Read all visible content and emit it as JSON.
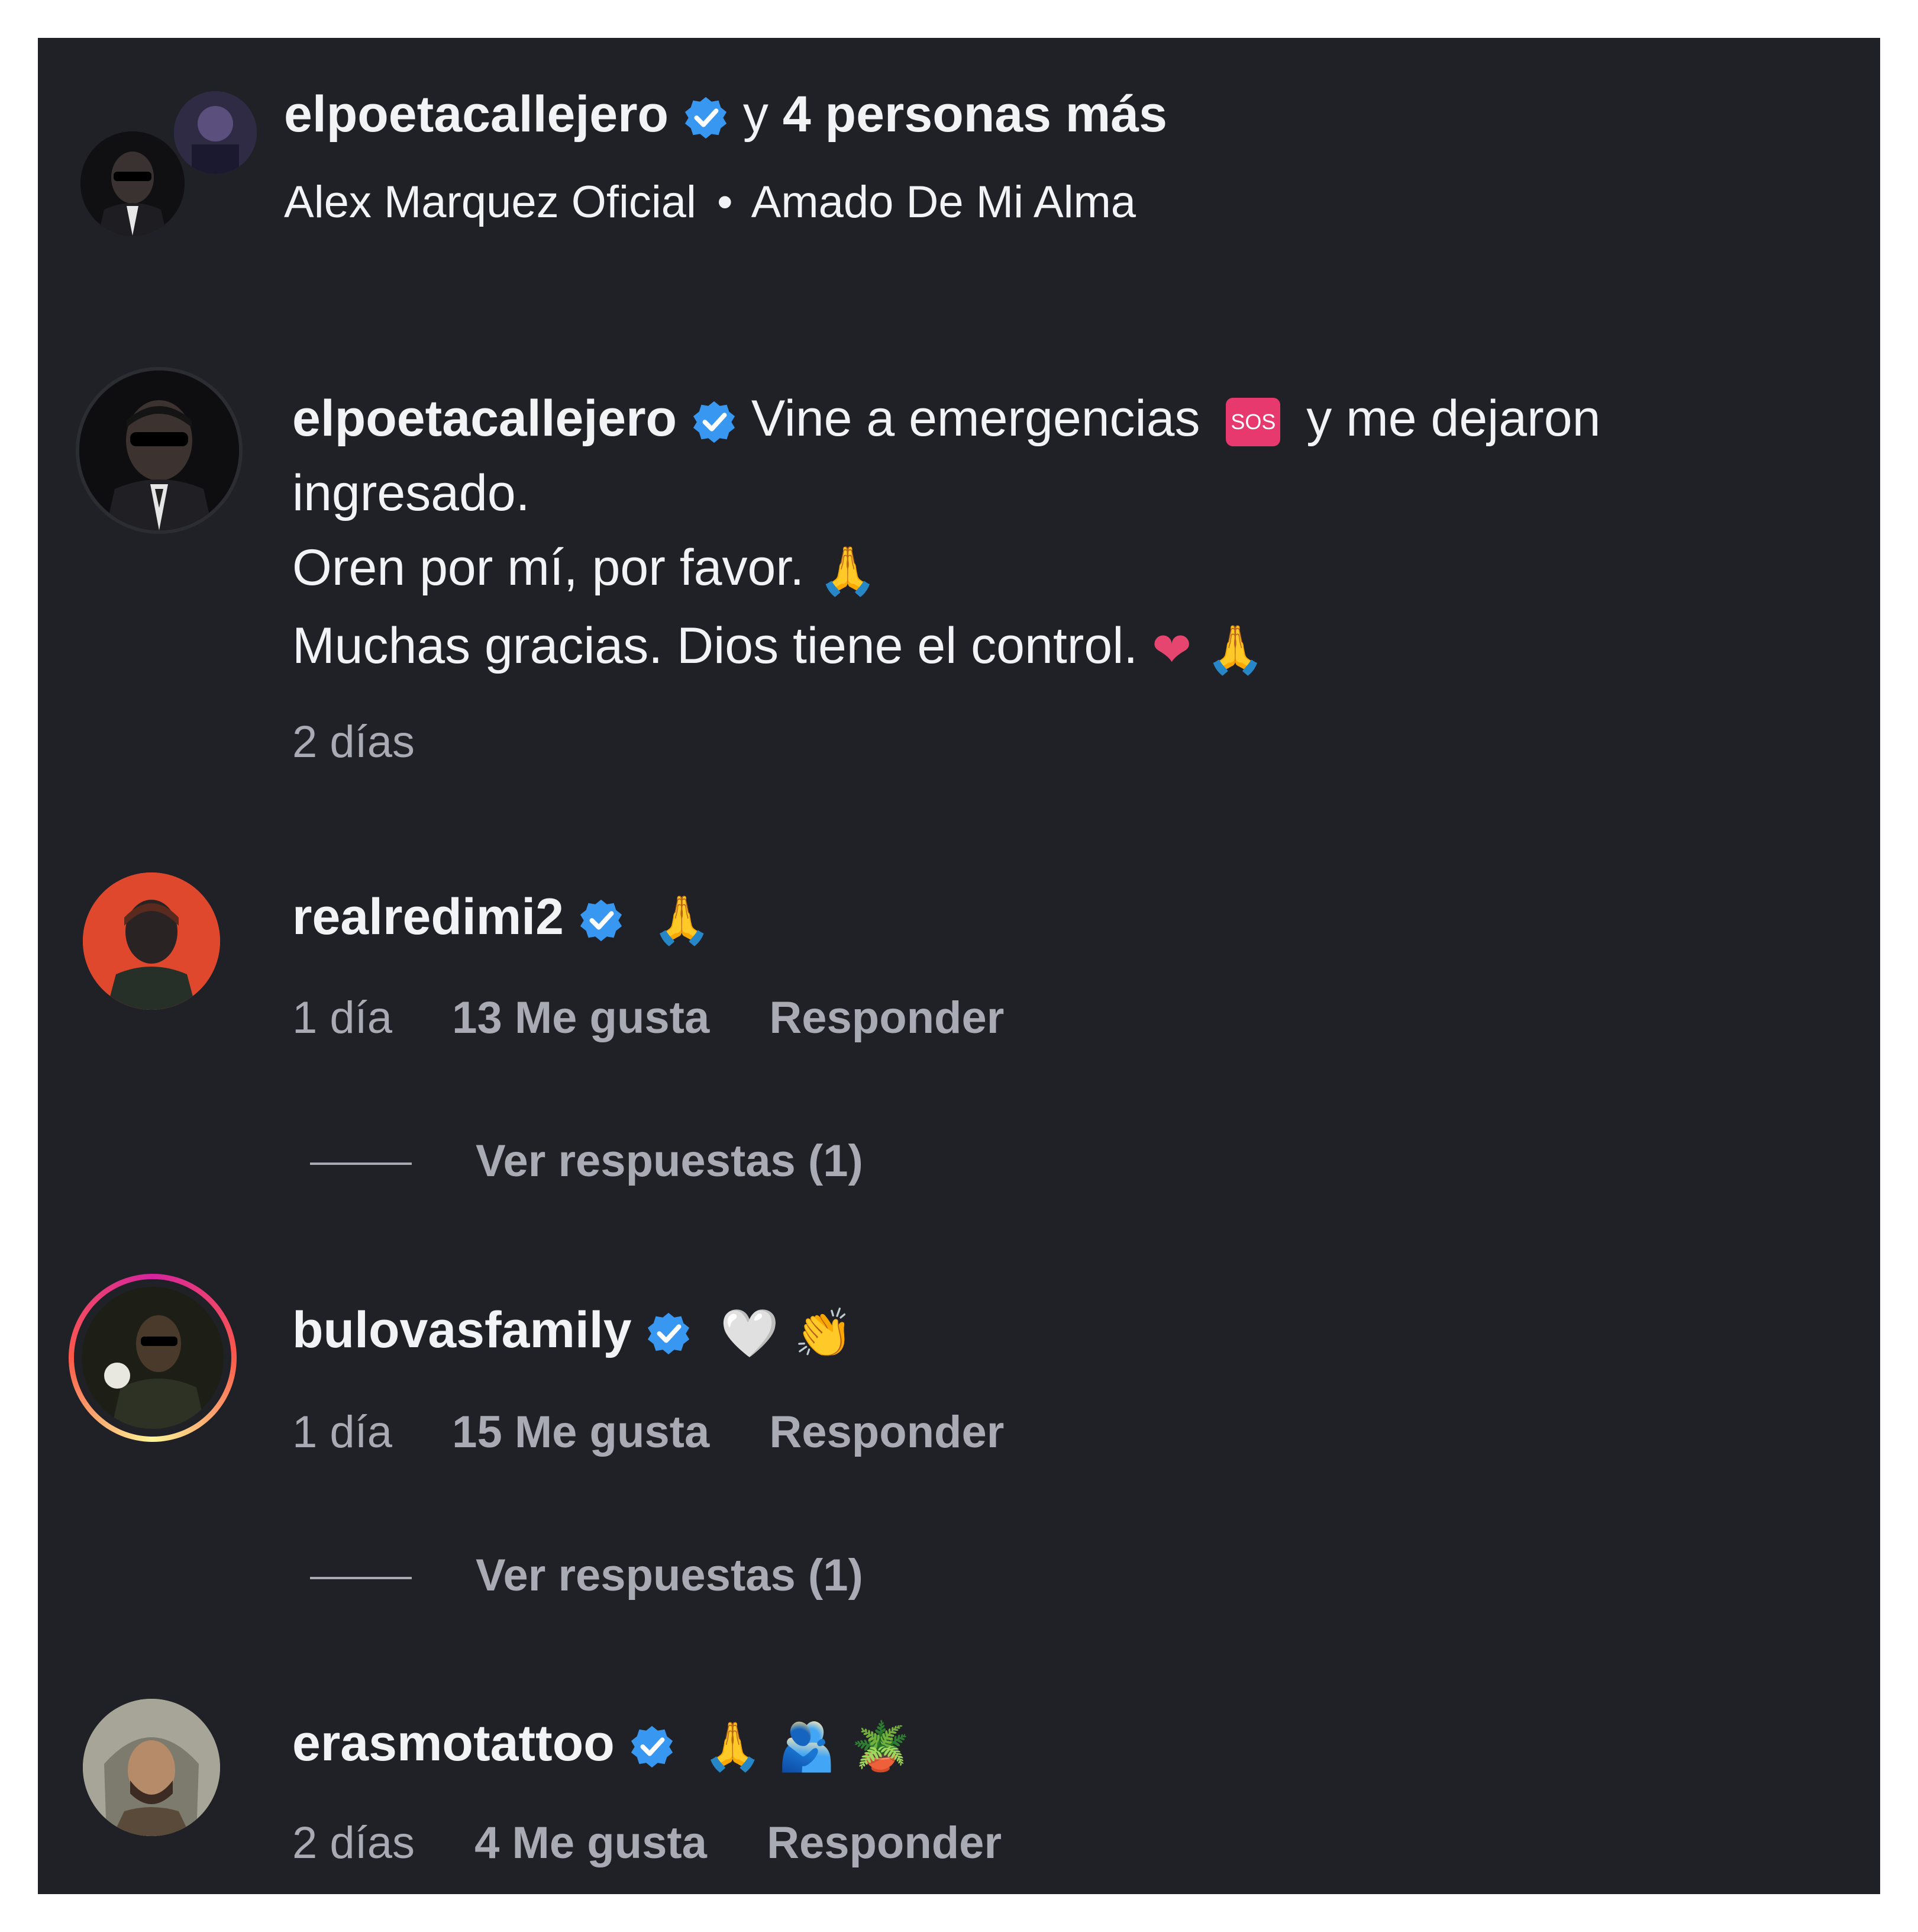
{
  "header": {
    "username": "elpoetacallejero",
    "joiner": "y",
    "others": "4 personas más",
    "audio_artist": "Alex Marquez Oficial",
    "separator": "•",
    "audio_title": "Amado De Mi Alma"
  },
  "caption": {
    "username": "elpoetacallejero",
    "text_part1": "Vine a emergencias",
    "sos_label": "SOS",
    "text_part2": "y me dejaron",
    "line2": "ingresado.",
    "line3": "Oren por mí, por favor.",
    "line4": "Muchas gracias. Dios tiene el control.",
    "time": "2 días"
  },
  "comments": [
    {
      "username": "realredimi2",
      "emojis": "🙏",
      "time": "1 día",
      "likes": "13 Me gusta",
      "reply": "Responder",
      "view_replies": "Ver respuestas (1)"
    },
    {
      "username": "bulovasfamily",
      "emojis": "🤍 👏",
      "time": "1 día",
      "likes": "15 Me gusta",
      "reply": "Responder",
      "view_replies": "Ver respuestas (1)"
    },
    {
      "username": "erasmotattoo",
      "emojis": "🙏 🫂 🪴",
      "time": "2 días",
      "likes": "4 Me gusta",
      "reply": "Responder"
    }
  ],
  "colors": {
    "background": "#202126",
    "text": "#f2f3f5",
    "muted": "#a8abb3",
    "verified": "#3897f0"
  }
}
